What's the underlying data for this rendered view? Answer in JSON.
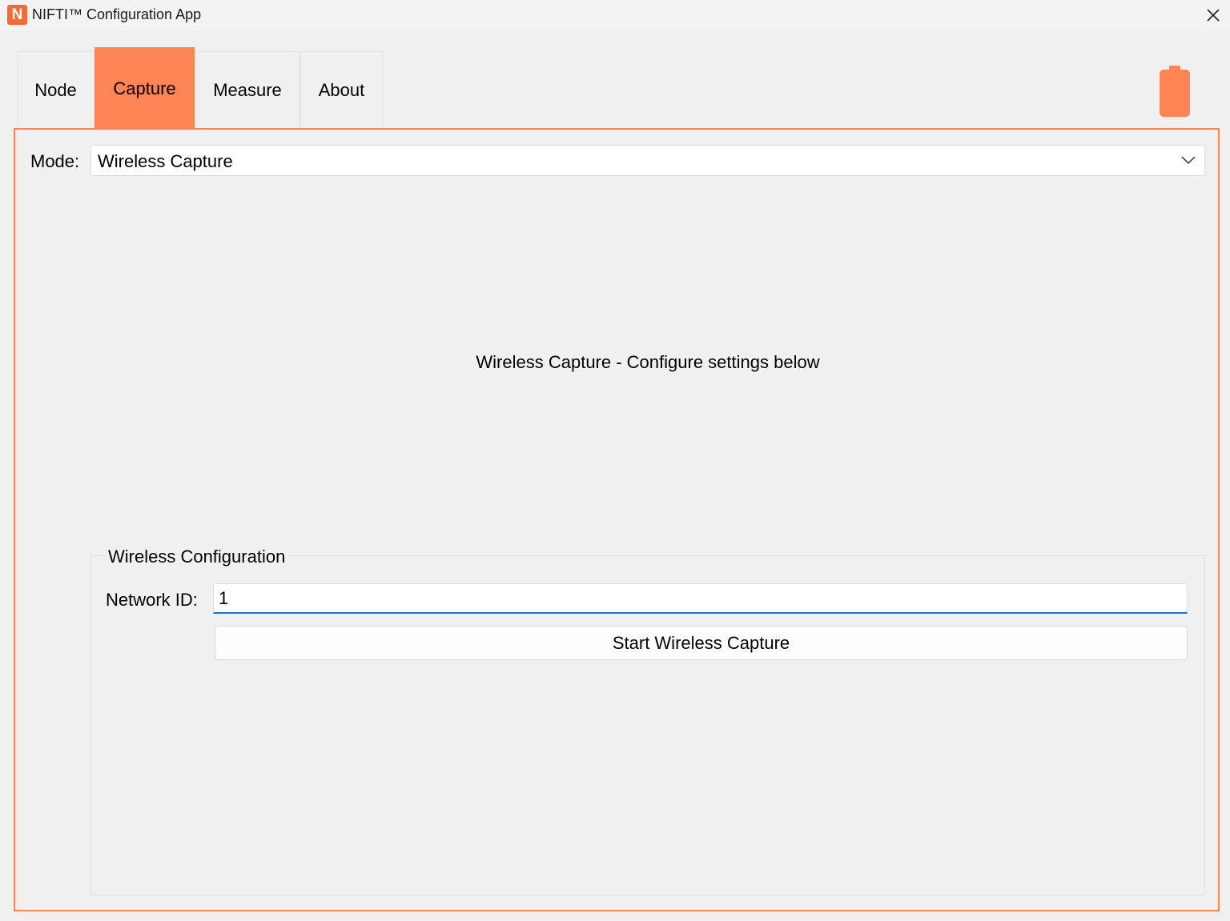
{
  "window": {
    "logo_letter": "N",
    "title": "NIFTI™ Configuration App"
  },
  "tabs": [
    {
      "label": "Node",
      "active": false
    },
    {
      "label": "Capture",
      "active": true
    },
    {
      "label": "Measure",
      "active": false
    },
    {
      "label": "About",
      "active": false
    }
  ],
  "colors": {
    "accent": "#ff8456",
    "focus_underline": "#1c6ec8"
  },
  "status": {
    "battery_icon": "battery-icon"
  },
  "capture": {
    "mode_label": "Mode:",
    "mode_value": "Wireless Capture",
    "info_text": "Wireless Capture - Configure settings below",
    "wireless_config": {
      "title": "Wireless Configuration",
      "network_id_label": "Network ID:",
      "network_id_value": "1",
      "start_button_label": "Start Wireless Capture"
    }
  }
}
